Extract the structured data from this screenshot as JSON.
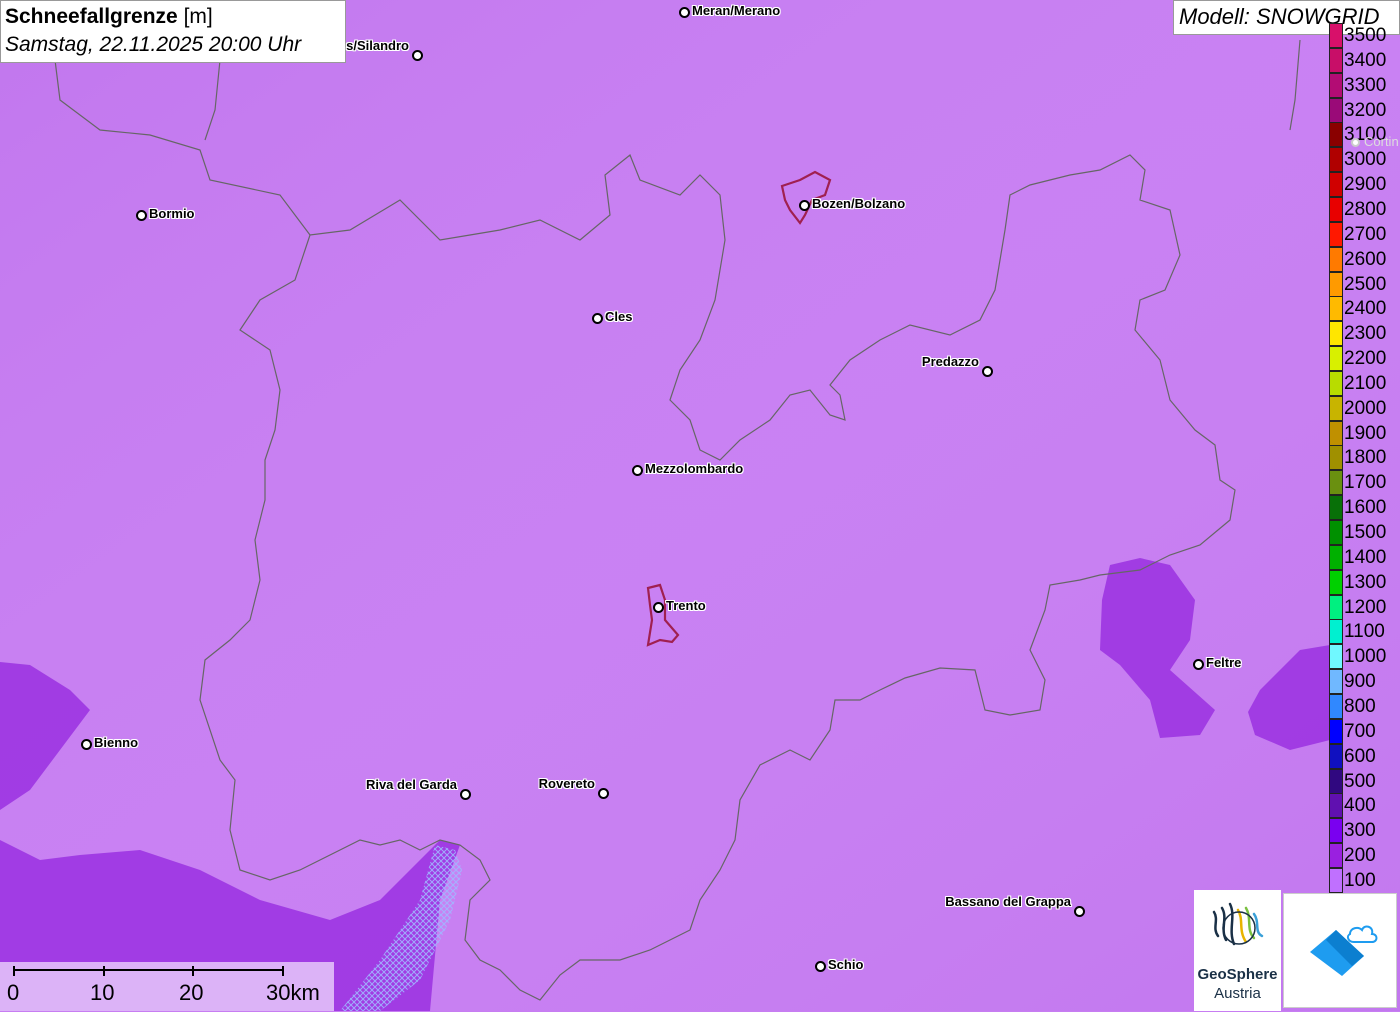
{
  "title": {
    "name": "Schneefallgrenze",
    "unit": "[m]",
    "datetime": "Samstag, 22.11.2025 20:00 Uhr"
  },
  "model": "Modell: SNOWGRID",
  "legend": [
    {
      "label": "3500",
      "color": "#d8106a"
    },
    {
      "label": "3400",
      "color": "#c80e68"
    },
    {
      "label": "3300",
      "color": "#b30c74"
    },
    {
      "label": "3200",
      "color": "#9a0a78"
    },
    {
      "label": "3100",
      "color": "#8a0000"
    },
    {
      "label": "3000",
      "color": "#b00000"
    },
    {
      "label": "2900",
      "color": "#d00000"
    },
    {
      "label": "2800",
      "color": "#e80000"
    },
    {
      "label": "2700",
      "color": "#ff1800"
    },
    {
      "label": "2600",
      "color": "#ff7a00"
    },
    {
      "label": "2500",
      "color": "#ff9a00"
    },
    {
      "label": "2400",
      "color": "#ffba00"
    },
    {
      "label": "2300",
      "color": "#ffe600"
    },
    {
      "label": "2200",
      "color": "#d8f000"
    },
    {
      "label": "2100",
      "color": "#b8dc00"
    },
    {
      "label": "2000",
      "color": "#c8b400"
    },
    {
      "label": "1900",
      "color": "#c09000"
    },
    {
      "label": "1800",
      "color": "#a09000"
    },
    {
      "label": "1700",
      "color": "#6a9010"
    },
    {
      "label": "1600",
      "color": "#087008"
    },
    {
      "label": "1500",
      "color": "#009000"
    },
    {
      "label": "1400",
      "color": "#00b000"
    },
    {
      "label": "1300",
      "color": "#00d000"
    },
    {
      "label": "1200",
      "color": "#00f080"
    },
    {
      "label": "1100",
      "color": "#00f0d0"
    },
    {
      "label": "1000",
      "color": "#70f8ff"
    },
    {
      "label": "900",
      "color": "#70b8ff"
    },
    {
      "label": "800",
      "color": "#3088ff"
    },
    {
      "label": "700",
      "color": "#0000ff"
    },
    {
      "label": "600",
      "color": "#1010c0"
    },
    {
      "label": "500",
      "color": "#300880"
    },
    {
      "label": "400",
      "color": "#6010b0"
    },
    {
      "label": "300",
      "color": "#7a00f0"
    },
    {
      "label": "200",
      "color": "#9a20e0"
    },
    {
      "label": "100",
      "color": "#c070ff"
    }
  ],
  "cities": [
    {
      "name": "Meran/Merano",
      "label_side": "right"
    },
    {
      "name": "s/Silandro",
      "label_side": "left"
    },
    {
      "name": "Bormio",
      "label_side": "right"
    },
    {
      "name": "Bozen/Bolzano",
      "label_side": "right"
    },
    {
      "name": "Cles",
      "label_side": "right"
    },
    {
      "name": "Predazzo",
      "label_side": "left"
    },
    {
      "name": "Mezzolombardo",
      "label_side": "right"
    },
    {
      "name": "Trento",
      "label_side": "right"
    },
    {
      "name": "Feltre",
      "label_side": "right"
    },
    {
      "name": "Bienno",
      "label_side": "right"
    },
    {
      "name": "Riva del Garda",
      "label_side": "left"
    },
    {
      "name": "Rovereto",
      "label_side": "left"
    },
    {
      "name": "Bassano del Grappa",
      "label_side": "left"
    },
    {
      "name": "Schio",
      "label_side": "right"
    },
    {
      "name": "Cortin",
      "label_side": "right"
    }
  ],
  "scale": {
    "labels": [
      "0",
      "10",
      "20",
      "30km"
    ]
  },
  "logos": {
    "geosphere_line1": "GeoSphere",
    "geosphere_line2": "Austria"
  },
  "colors": {
    "base_field": "#c77df2",
    "low_field": "#9a30e0",
    "border_line": "#666666",
    "city_outline": "#a02050"
  }
}
